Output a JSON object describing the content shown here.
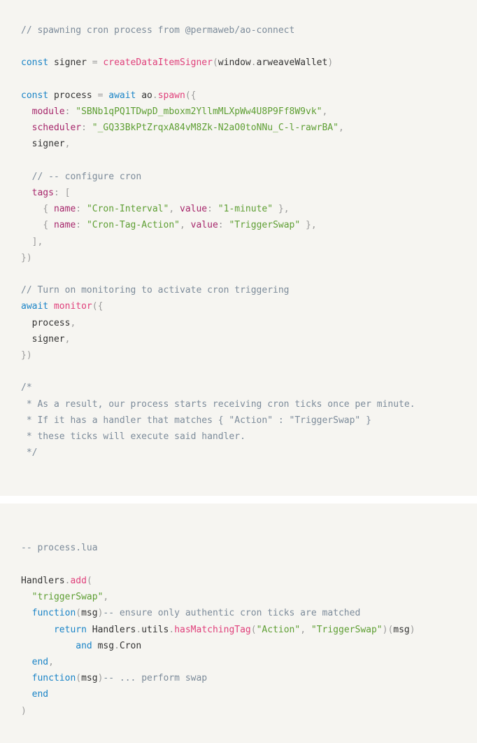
{
  "page": {
    "background": "#ffffff",
    "block_background": "#f6f5f1",
    "gap_color": "#ffffff"
  },
  "theme": {
    "comment": "#7c8b9a",
    "keyword": "#1a84c7",
    "function": "#e0407b",
    "string": "#5d9e32",
    "property": "#a6266b",
    "identifier": "#333333",
    "punctuation": "#9b9b9b"
  },
  "blocks": [
    {
      "name": "javascript-ao-connect-snippet",
      "language": "javascript",
      "lines": [
        "// spawning cron process from @permaweb/ao-connect",
        "",
        "const signer = createDataItemSigner(window.arweaveWallet)",
        "",
        "const process = await ao.spawn({",
        "  module: \"SBNb1qPQ1TDwpD_mboxm2YllmMLXpWw4U8P9Ff8W9vk\",",
        "  scheduler: \"_GQ33BkPtZrqxA84vM8Zk-N2aO0toNNu_C-l-rawrBA\",",
        "  signer,",
        "",
        "  // -- configure cron",
        "  tags: [",
        "    { name: \"Cron-Interval\", value: \"1-minute\" },",
        "    { name: \"Cron-Tag-Action\", value: \"TriggerSwap\" },",
        "  ],",
        "})",
        "",
        "// Turn on monitoring to activate cron triggering",
        "await monitor({",
        "  process,",
        "  signer,",
        "})",
        "",
        "/*",
        " * As a result, our process starts receiving cron ticks once per minute.",
        " * If it has a handler that matches { \"Action\" : \"TriggerSwap\" }",
        " * these ticks will execute said handler.",
        " */"
      ]
    },
    {
      "name": "lua-process-handler-snippet",
      "language": "lua",
      "lines": [
        "-- process.lua",
        "",
        "Handlers.add(",
        "  \"triggerSwap\",",
        "  function(msg)-- ensure only authentic cron ticks are matched",
        "      return Handlers.utils.hasMatchingTag(\"Action\", \"TriggerSwap\")(msg)",
        "          and msg.Cron",
        "  end,",
        "  function(msg)-- ... perform swap",
        "  end",
        ")"
      ]
    }
  ]
}
